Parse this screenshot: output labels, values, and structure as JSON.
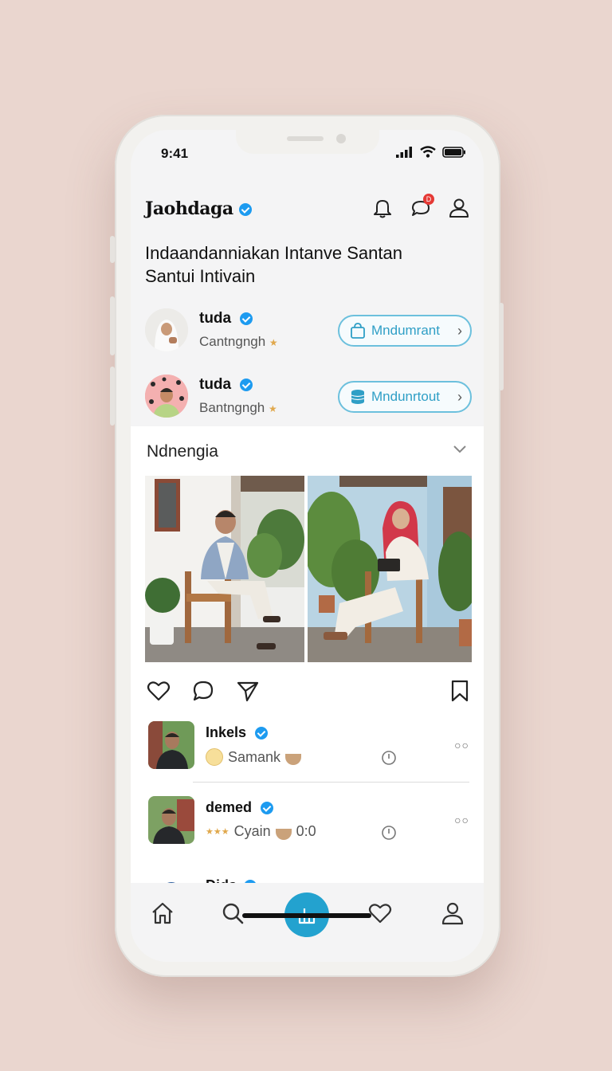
{
  "status_bar": {
    "time": "9:41"
  },
  "header": {
    "brand": "Jaohdaga",
    "message_badge": "D"
  },
  "headline": {
    "line1": "Indaandanniakan Intanve Santan",
    "line2": "Santui Intivain"
  },
  "suggestions": [
    {
      "name": "tuda",
      "subtitle": "Cantngngh",
      "button_label": "Mndumrant",
      "button_icon": "shopping-bag-icon"
    },
    {
      "name": "tuda",
      "subtitle": "Bantngngh",
      "button_label": "Mndunrtout",
      "button_icon": "database-icon"
    }
  ],
  "feed": {
    "title": "Ndnengia"
  },
  "comments": [
    {
      "name": "Inkels",
      "text": "Samank"
    },
    {
      "name": "demed",
      "text": "Cyain",
      "extra": "0:0"
    },
    {
      "name": "Dids"
    }
  ],
  "colors": {
    "accent": "#23a2cf",
    "verified": "#1d9bf0",
    "pill_border": "#6cc0dd",
    "background": "#ead6cf"
  }
}
